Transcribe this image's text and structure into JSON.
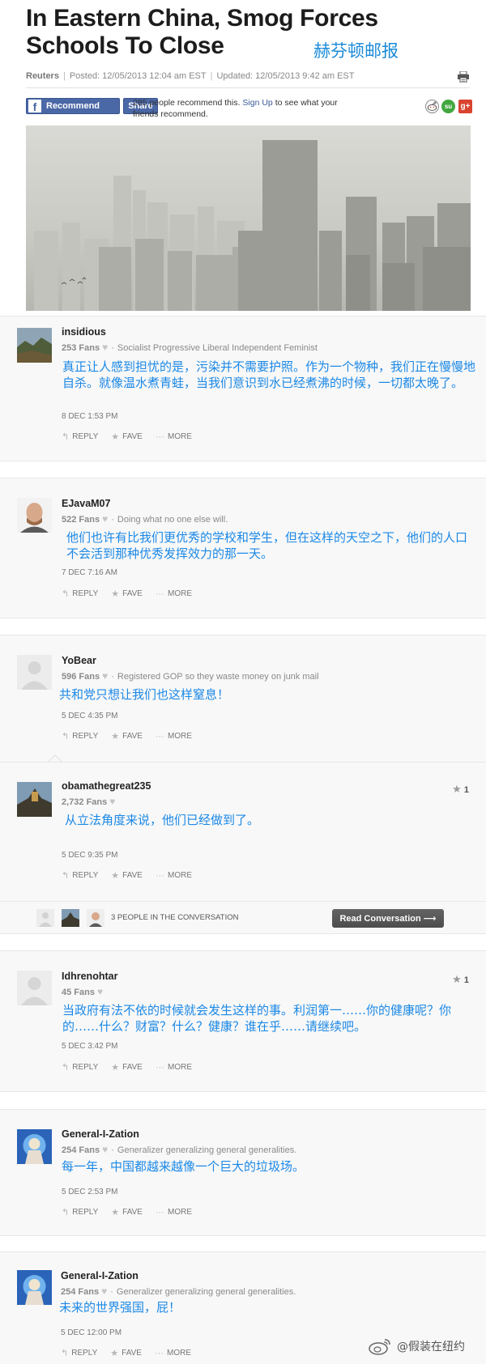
{
  "article": {
    "headline": "In Eastern China, Smog Forces Schools To Close",
    "source_cn": "赫芬顿邮报",
    "byline": {
      "source": "Reuters",
      "posted": "Posted: 12/05/2013 12:04 am EST",
      "updated": "Updated: 12/05/2013 9:42 am EST"
    },
    "recommend_label": "Recommend",
    "share_label": "Share",
    "recommend_count_text": "285 people recommend this.",
    "signup_label": "Sign Up",
    "recommend_suffix": "to see what your friends recommend.",
    "stumble_label": "su",
    "gplus_label": "g+"
  },
  "action_labels": {
    "reply": "REPLY",
    "fave": "FAVE",
    "more": "MORE"
  },
  "comments": [
    {
      "username": "insidious",
      "fans": "253 Fans",
      "tagline": "Socialist Progressive Liberal Independent Feminist",
      "text": "真正让人感到担忧的是，污染并不需要护照。作为一个物种，我们正在慢慢地自杀。就像温水煮青蛙，当我们意识到水已经煮沸的时候，一切都太晚了。",
      "time": "8 DEC 1:53 PM"
    },
    {
      "username": "EJavaM07",
      "fans": "522 Fans",
      "tagline": "Doing what no one else will.",
      "text": "他们也许有比我们更优秀的学校和学生，但在这样的天空之下，他们的人口不会活到那种优秀发挥效力的那一天。",
      "time": "7 DEC 7:16 AM"
    },
    {
      "username": "YoBear",
      "fans": "596 Fans",
      "tagline": "Registered GOP so they waste money on junk mail",
      "text": "共和党只想让我们也这样窒息！",
      "time": "5 DEC 4:35 PM"
    },
    {
      "username": "obamathegreat235",
      "fans": "2,732 Fans",
      "tagline": "",
      "text": "从立法角度来说，他们已经做到了。",
      "time": "5 DEC 9:35 PM",
      "stars": "1"
    },
    {
      "username": "Idhrenohtar",
      "fans": "45 Fans",
      "tagline": "",
      "text": "当政府有法不依的时候就会发生这样的事。利润第一……你的健康呢？你的……什么？财富？什么？健康？谁在乎……请继续吧。",
      "time": "5 DEC 3:42 PM",
      "stars": "1"
    },
    {
      "username": "General-I-Zation",
      "fans": "254 Fans",
      "tagline": "Generalizer generalizing general generalities.",
      "text": "每一年，中国都越来越像一个巨大的垃圾场。",
      "time": "5 DEC 2:53 PM"
    },
    {
      "username": "General-I-Zation",
      "fans": "254 Fans",
      "tagline": "Generalizer generalizing general generalities.",
      "text": "未来的世界强国，屁！",
      "time": "5 DEC 12:00 PM"
    }
  ],
  "conversation": {
    "people_text": "3 PEOPLE IN THE CONVERSATION",
    "button_label": "Read Conversation ⟶"
  },
  "watermark": {
    "text": "@假装在纽约"
  },
  "icons": {
    "facebook": "facebook-icon",
    "print": "print-icon",
    "reddit": "reddit-icon",
    "stumbleupon": "stumbleupon-icon",
    "googleplus": "google-plus-icon",
    "heart": "heart-icon",
    "reply": "reply-icon",
    "fave": "star-icon",
    "more": "more-dots-icon",
    "weibo": "weibo-icon"
  },
  "colors": {
    "facebook_blue": "#4a67a6",
    "translation_blue": "#1b88e6",
    "comment_bg": "#f8f8f8",
    "read_button": "#555555"
  }
}
